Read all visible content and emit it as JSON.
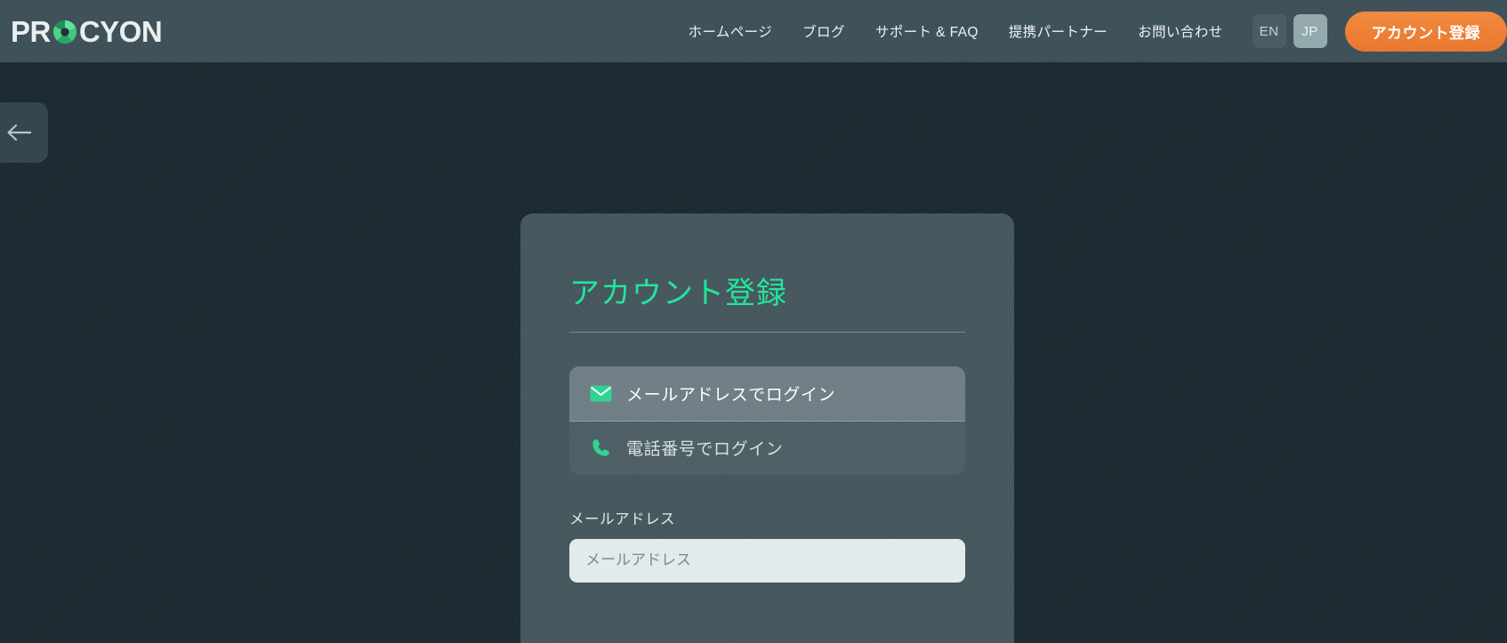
{
  "brand": {
    "name_part1": "PR",
    "name_part2": "CYON",
    "logo_icon": "aperture-icon",
    "accent_green": "#35c97d"
  },
  "header": {
    "background": "#3f5158",
    "nav_items": [
      {
        "label": "ホームページ",
        "name": "nav-item-homepage"
      },
      {
        "label": "ブログ",
        "name": "nav-item-blog"
      },
      {
        "label": "サポート & FAQ",
        "name": "nav-item-support-faq"
      },
      {
        "label": "提携パートナー",
        "name": "nav-item-partners"
      },
      {
        "label": "お問い合わせ",
        "name": "nav-item-contact"
      }
    ],
    "languages": [
      {
        "label": "EN",
        "active": false
      },
      {
        "label": "JP",
        "active": true
      }
    ],
    "cta": {
      "label": "アカウント登録",
      "color": "#ed7c30"
    }
  },
  "back_button": {
    "icon": "arrow-left-icon",
    "label": ""
  },
  "card": {
    "title": "アカウント登録",
    "title_color": "#21e59a",
    "tabs": [
      {
        "label": "メールアドレスでログイン",
        "icon": "envelope-icon",
        "active": true
      },
      {
        "label": "電話番号でログイン",
        "icon": "phone-icon",
        "active": false
      }
    ],
    "fields": [
      {
        "label": "メールアドレス",
        "placeholder": "メールアドレス",
        "value": ""
      }
    ]
  }
}
